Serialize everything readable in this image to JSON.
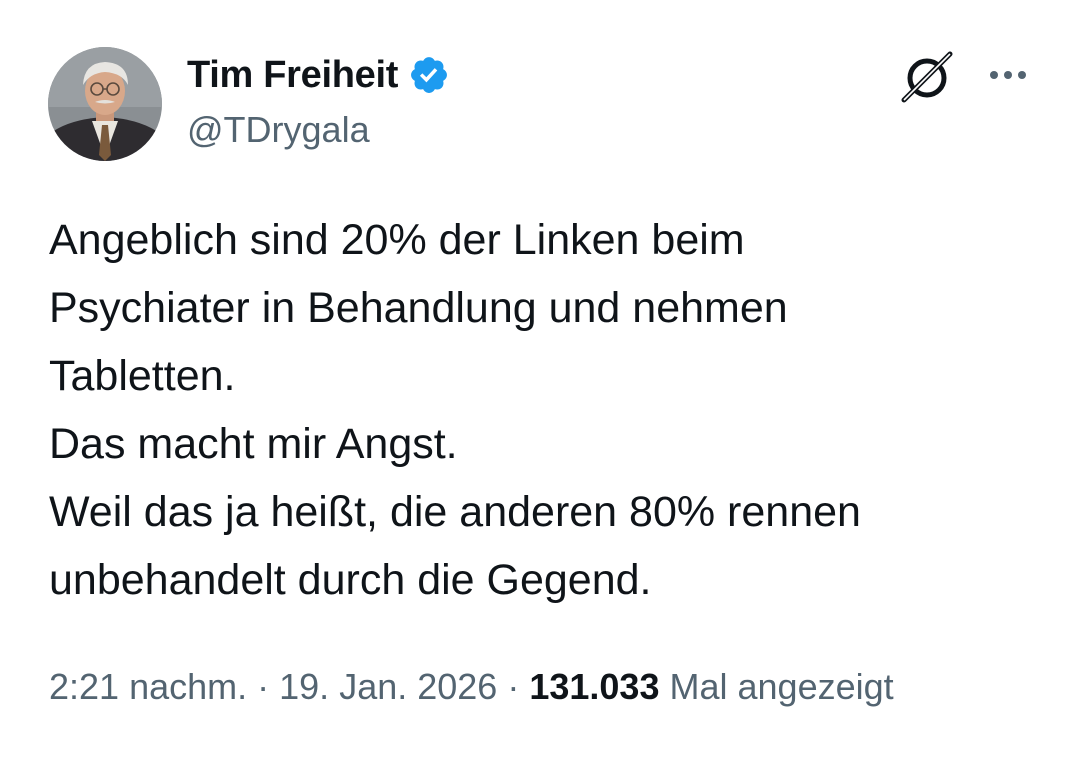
{
  "author": {
    "display_name": "Tim Freiheit",
    "handle": "@TDrygala",
    "verified": true,
    "verified_color": "#1d9bf0"
  },
  "icons": {
    "verified": "verified-badge-icon",
    "grok": "grok-icon",
    "more": "more-options-icon",
    "avatar": "profile-avatar"
  },
  "tweet": {
    "lines": [
      "Angeblich sind 20% der Linken beim",
      "Psychiater in Behandlung und nehmen",
      "Tabletten.",
      "Das macht mir Angst.",
      "Weil das ja heißt, die anderen 80% rennen",
      "unbehandelt durch die Gegend."
    ]
  },
  "meta": {
    "time": "2:21 nachm.",
    "separator": "·",
    "date": "19. Jan. 2026",
    "views": "131.033",
    "views_label": "Mal angezeigt"
  },
  "colors": {
    "text_primary": "#0f1419",
    "text_secondary": "#536471",
    "background": "#ffffff"
  }
}
